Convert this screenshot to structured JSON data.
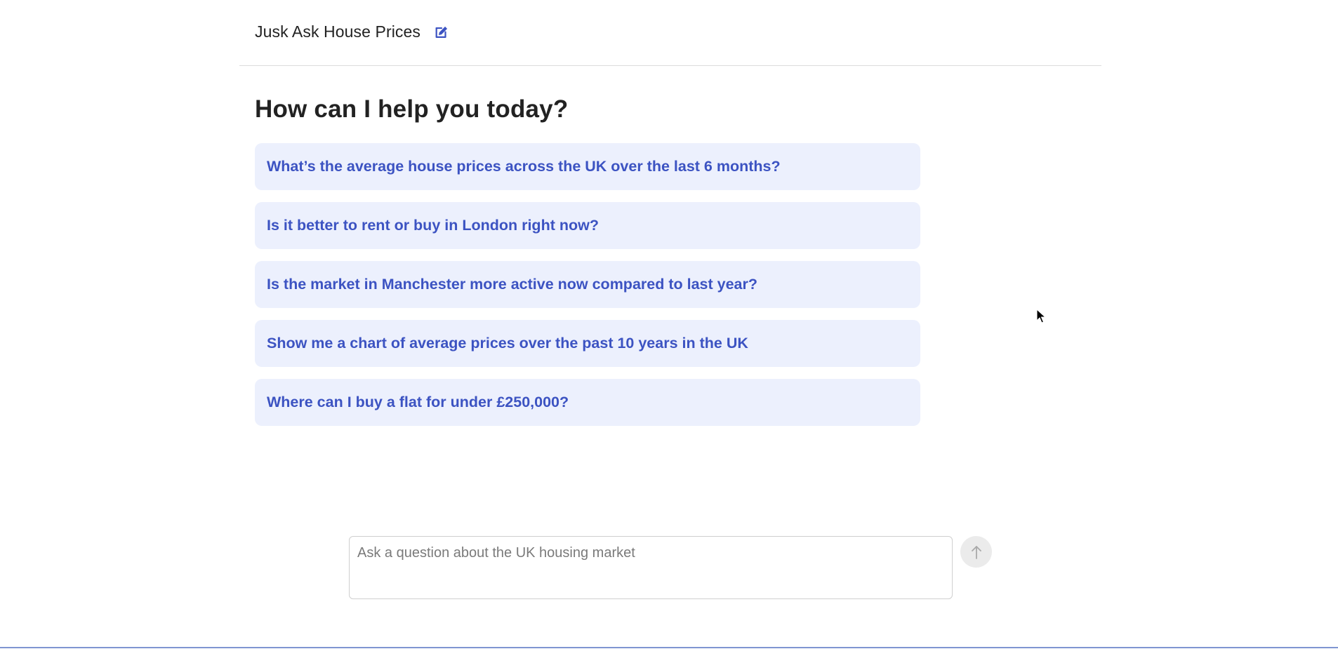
{
  "header": {
    "title": "Jusk Ask House Prices",
    "edit_icon": "edit-icon"
  },
  "main": {
    "greeting": "How can I help you today?",
    "suggestions": [
      {
        "label": "What’s the average house prices across the UK over the last 6 months?"
      },
      {
        "label": "Is it better to rent or buy in London right now?"
      },
      {
        "label": "Is the market in Manchester more active now compared to last year?"
      },
      {
        "label": "Show me a chart of average prices over the past 10 years in the UK"
      },
      {
        "label": "Where can I buy a flat for under £250,000?"
      }
    ]
  },
  "composer": {
    "value": "",
    "placeholder": "Ask a question about the UK housing market",
    "send_icon": "arrow-up-icon"
  },
  "colors": {
    "accent": "#3c53c2",
    "suggestion_bg": "#ecf0fd",
    "send_button_bg": "#ebebeb",
    "bottom_accent": "#7f95d1"
  }
}
